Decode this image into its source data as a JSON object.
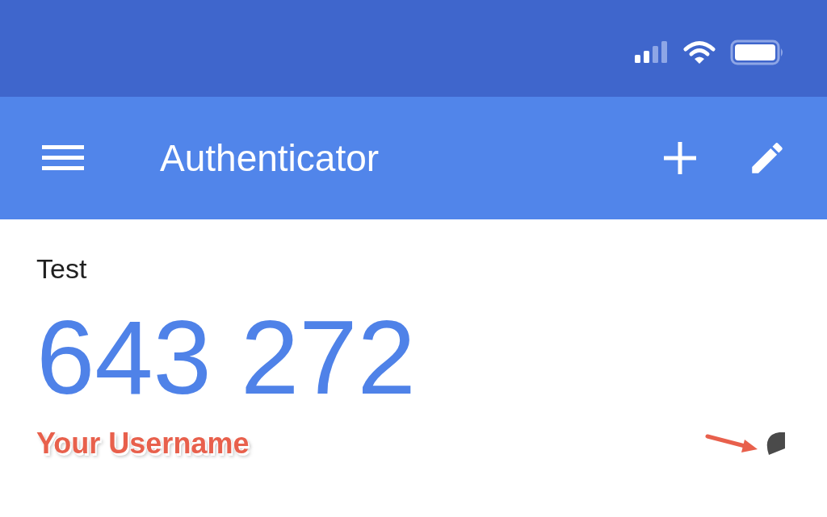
{
  "app_bar": {
    "title": "Authenticator"
  },
  "account": {
    "issuer": "Test",
    "code": "643 272",
    "annotation": "Your Username"
  }
}
